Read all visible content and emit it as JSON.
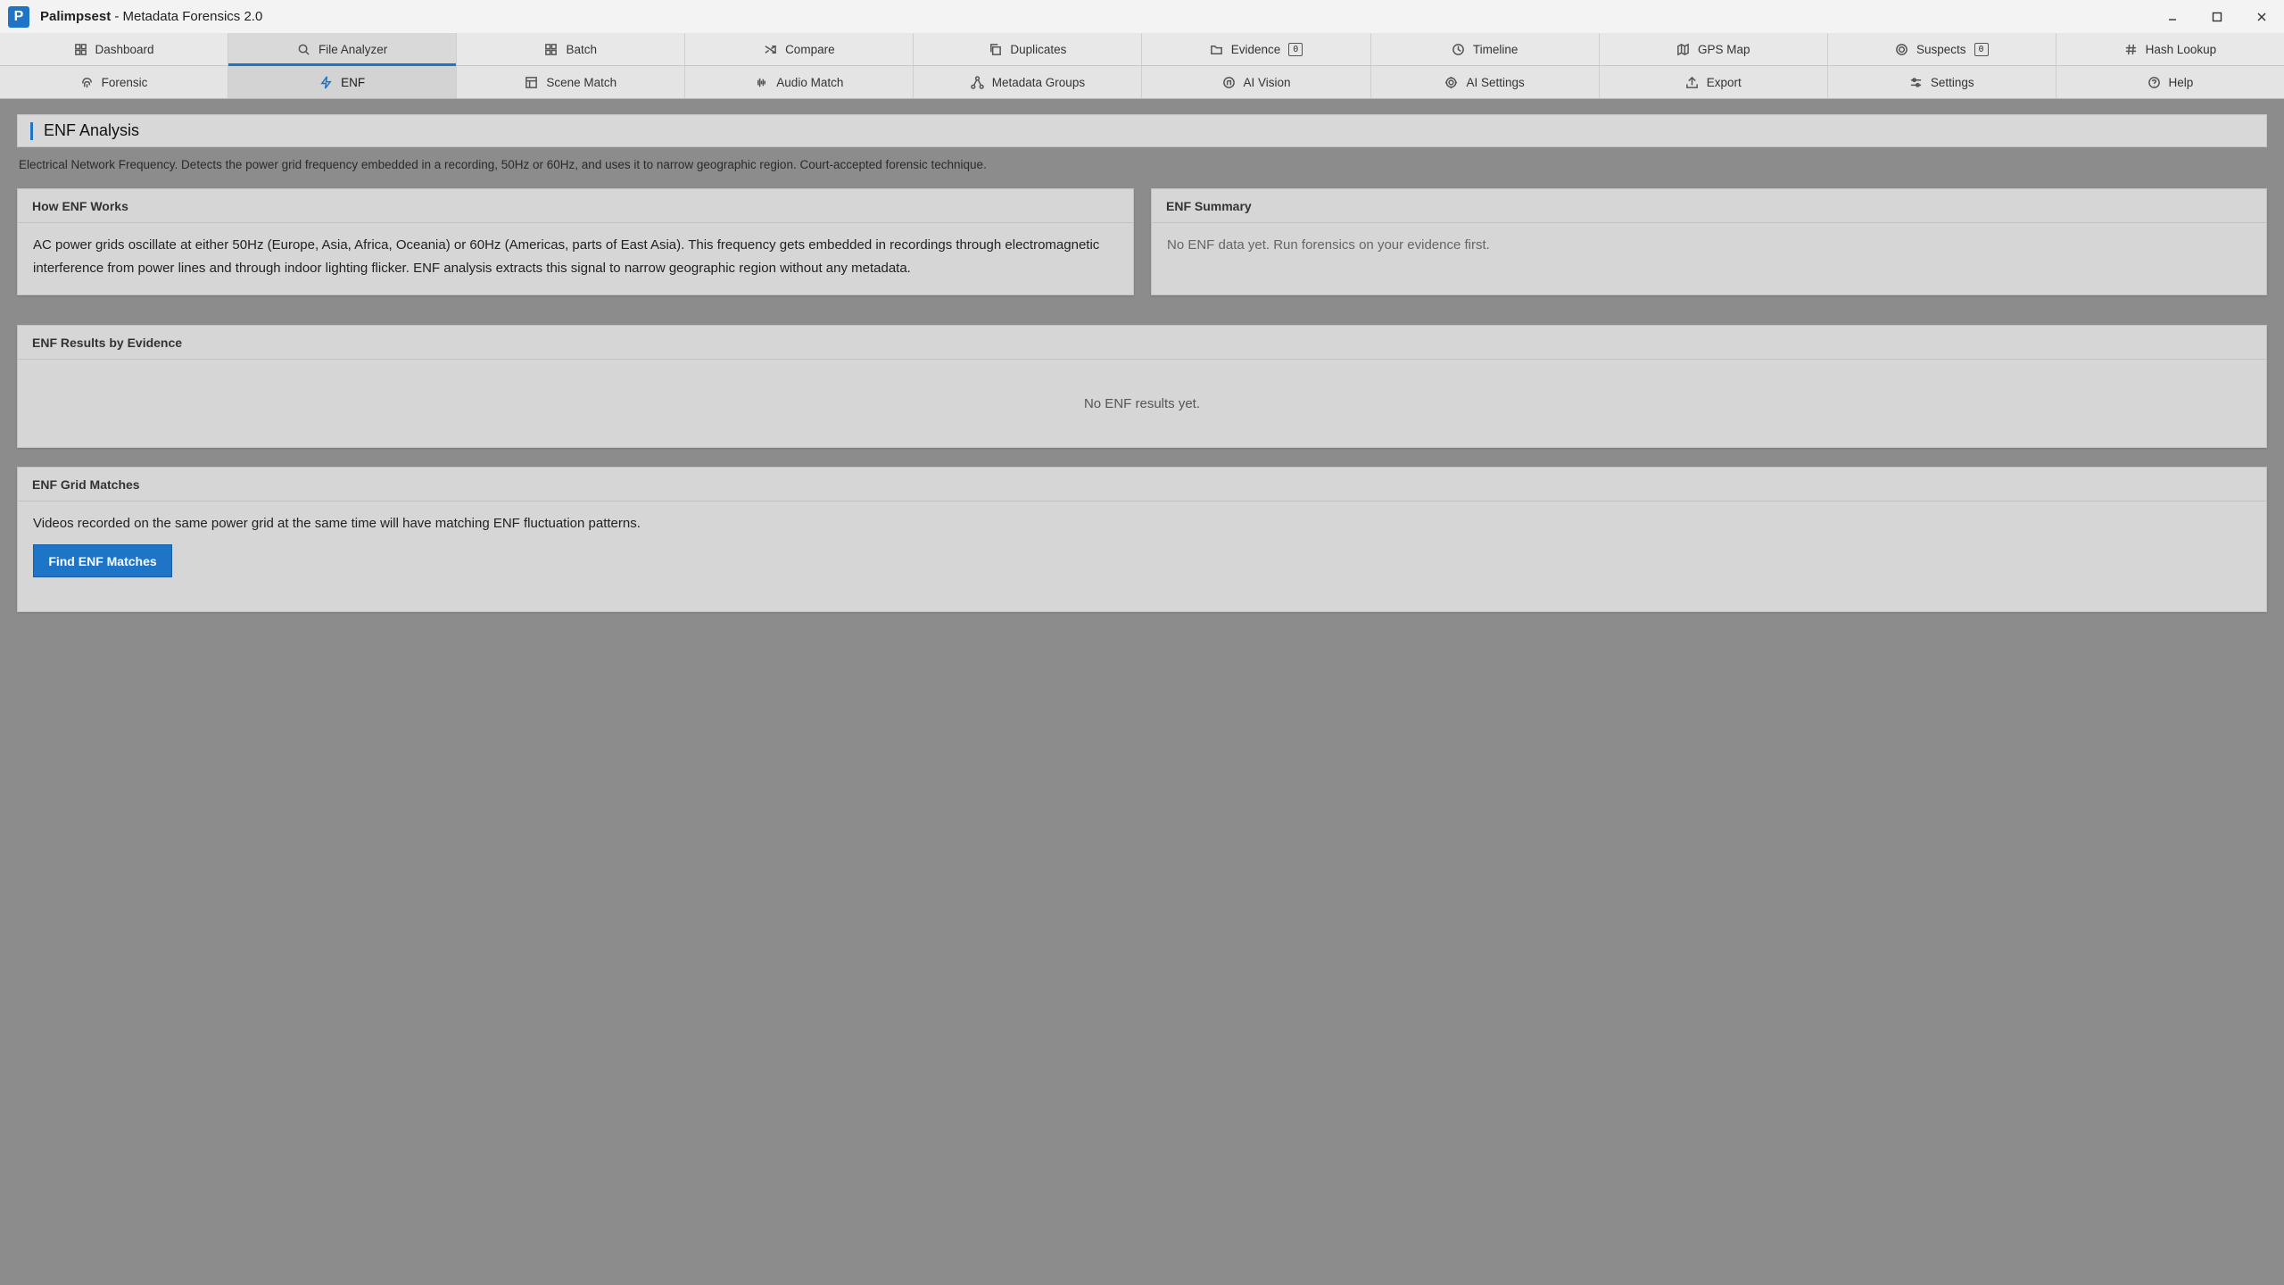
{
  "window": {
    "app_name": "Palimpsest",
    "title_suffix": " - Metadata Forensics 2.0",
    "logo_letter": "P"
  },
  "tabs_row1": [
    {
      "label": "Dashboard",
      "icon": "grid-icon"
    },
    {
      "label": "File Analyzer",
      "icon": "search-icon",
      "active": true
    },
    {
      "label": "Batch",
      "icon": "batch-grid-icon"
    },
    {
      "label": "Compare",
      "icon": "shuffle-icon"
    },
    {
      "label": "Duplicates",
      "icon": "copy-icon"
    },
    {
      "label": "Evidence",
      "icon": "folder-icon",
      "badge": "0"
    },
    {
      "label": "Timeline",
      "icon": "clock-icon"
    },
    {
      "label": "GPS Map",
      "icon": "map-icon"
    },
    {
      "label": "Suspects",
      "icon": "target-icon",
      "badge": "0"
    },
    {
      "label": "Hash Lookup",
      "icon": "hash-icon"
    }
  ],
  "tabs_row2": [
    {
      "label": "Forensic",
      "icon": "fingerprint-icon"
    },
    {
      "label": "ENF",
      "icon": "lightning-icon",
      "active": true
    },
    {
      "label": "Scene Match",
      "icon": "frame-icon"
    },
    {
      "label": "Audio Match",
      "icon": "waveform-icon"
    },
    {
      "label": "Metadata Groups",
      "icon": "network-icon"
    },
    {
      "label": "AI Vision",
      "icon": "ai-icon"
    },
    {
      "label": "AI Settings",
      "icon": "gear-icon"
    },
    {
      "label": "Export",
      "icon": "upload-icon"
    },
    {
      "label": "Settings",
      "icon": "sliders-icon"
    },
    {
      "label": "Help",
      "icon": "help-icon"
    }
  ],
  "page": {
    "title": "ENF Analysis",
    "description": "Electrical Network Frequency. Detects the power grid frequency embedded in a recording, 50Hz or 60Hz, and uses it to narrow geographic region. Court-accepted forensic technique."
  },
  "how_panel": {
    "title": "How ENF Works",
    "body": "AC power grids oscillate at either 50Hz (Europe, Asia, Africa, Oceania) or 60Hz (Americas, parts of East Asia). This frequency gets embedded in recordings through electromagnetic interference from power lines and through indoor lighting flicker. ENF analysis extracts this signal to narrow geographic region without any metadata."
  },
  "summary_panel": {
    "title": "ENF Summary",
    "empty": "No ENF data yet. Run forensics on your evidence first."
  },
  "results_panel": {
    "title": "ENF Results by Evidence",
    "empty": "No ENF results yet."
  },
  "matches_panel": {
    "title": "ENF Grid Matches",
    "body": "Videos recorded on the same power grid at the same time will have matching ENF fluctuation patterns.",
    "button": "Find ENF Matches"
  },
  "colors": {
    "accent": "#1e74c6",
    "background": "#8c8c8c"
  }
}
